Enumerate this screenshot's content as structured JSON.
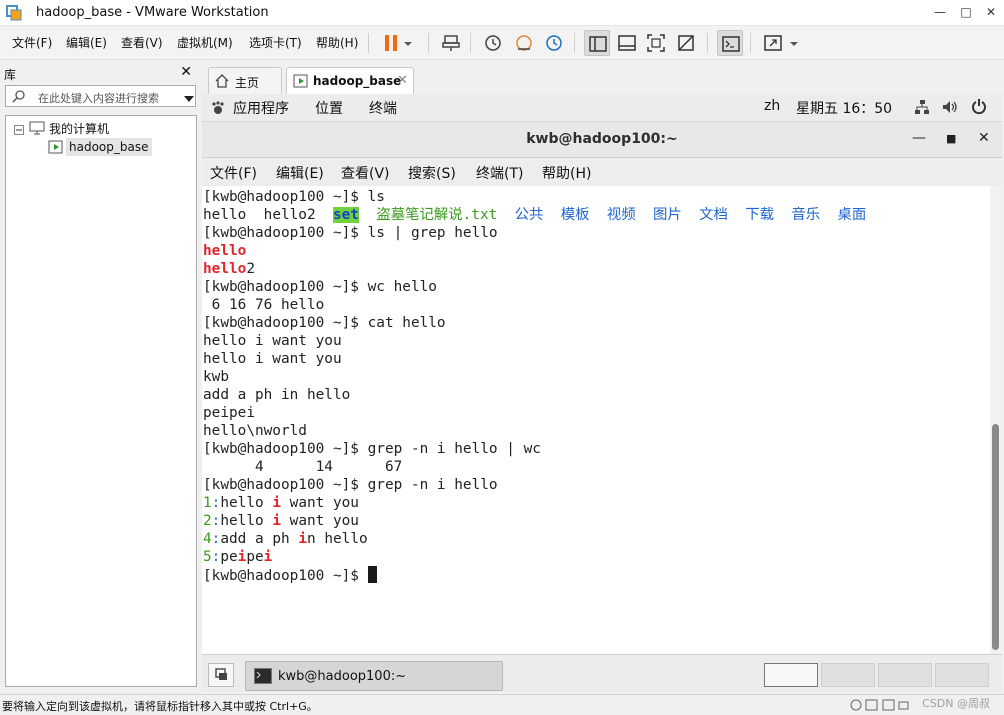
{
  "window": {
    "title": "hadoop_base - VMware Workstation"
  },
  "menubar": {
    "items": [
      "文件(F)",
      "编辑(E)",
      "查看(V)",
      "虚拟机(M)",
      "选项卡(T)",
      "帮助(H)"
    ]
  },
  "library": {
    "title": "库",
    "search_placeholder": "在此处键入内容进行搜索",
    "tree": {
      "root": "我的计算机",
      "child": "hadoop_base"
    }
  },
  "tabs": [
    {
      "label": "主页"
    },
    {
      "label": "hadoop_base"
    }
  ],
  "guest_panel": {
    "applications": "应用程序",
    "places": "位置",
    "terminal": "终端",
    "lang": "zh",
    "clock": "星期五 16：50"
  },
  "terminal": {
    "title": "kwb@hadoop100:~",
    "menu": [
      "文件(F)",
      "编辑(E)",
      "查看(V)",
      "搜索(S)",
      "终端(T)",
      "帮助(H)"
    ],
    "prompt": "[kwb@hadoop100 ~]$",
    "cmd_ls": "ls",
    "ls_files": [
      "hello",
      "hello2",
      "set",
      "盗墓笔记解说.txt",
      "公共",
      "模板",
      "视频",
      "图片",
      "文档",
      "下载",
      "音乐",
      "桌面"
    ],
    "cmd_ls_grep": "ls | grep hello",
    "grep_match": "hello",
    "grep_match2_suffix": "2",
    "cmd_wc": "wc hello",
    "wc_out": " 6 16 76 hello",
    "cmd_cat": "cat hello",
    "cat_lines": [
      "hello i want you",
      "hello i want you",
      "kwb",
      "add a ph in hello",
      "peipei",
      "hello\\nworld"
    ],
    "cmd_grep_wc": "grep -n i hello | wc",
    "grep_wc_out": "      4      14      67",
    "cmd_grep_n": "grep -n i hello",
    "grep_n": {
      "l1_num": "1",
      "l1_a": "hello ",
      "l1_m": "i",
      "l1_b": " want you",
      "l2_num": "2",
      "l2_a": "hello ",
      "l2_m": "i",
      "l2_b": " want you",
      "l3_num": "4",
      "l3_a": "add a ph ",
      "l3_m": "i",
      "l3_b": "n hello",
      "l4_num": "5",
      "l4_a": "pe",
      "l4_m1": "i",
      "l4_mid": "pe",
      "l4_m2": "i"
    },
    "sep": ":"
  },
  "taskbar": {
    "terminal_button": "kwb@hadoop100:~"
  },
  "statusbar": {
    "message": "要将输入定向到该虚拟机，请将鼠标指针移入其中或按 Ctrl+G。",
    "watermark": "CSDN @周叔"
  }
}
